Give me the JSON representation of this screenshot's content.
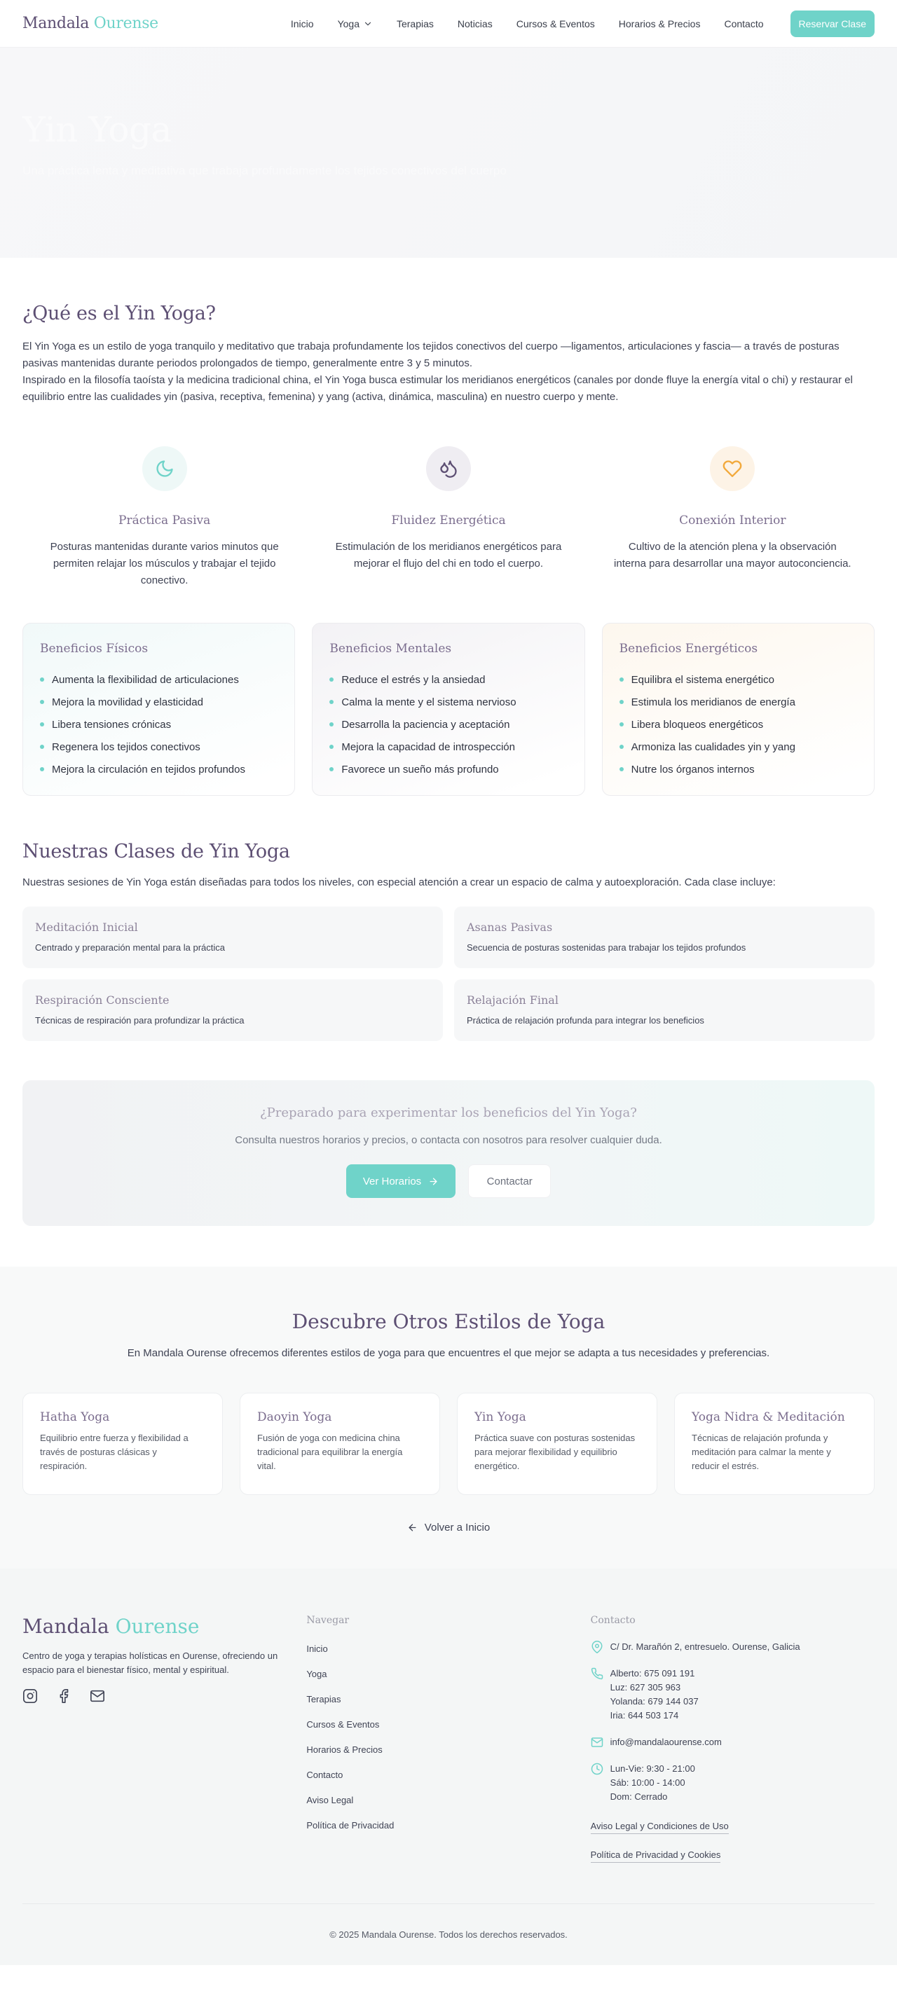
{
  "nav": {
    "logo_main": "Mandala",
    "logo_accent": "Ourense",
    "links": [
      "Inicio",
      "Yoga",
      "Terapias",
      "Noticias",
      "Cursos & Eventos",
      "Horarios & Precios",
      "Contacto"
    ],
    "cta": "Reservar Clase"
  },
  "hero": {
    "title": "Yin Yoga",
    "subtitle": "Una práctica lenta y meditativa que trabaja profundamente los tejidos conectivos del cuerpo"
  },
  "intro": {
    "title": "¿Qué es el Yin Yoga?",
    "p1": "El Yin Yoga es un estilo de yoga tranquilo y meditativo que trabaja profundamente los tejidos conectivos del cuerpo —ligamentos, articulaciones y fascia— a través de posturas pasivas mantenidas durante periodos prolongados de tiempo, generalmente entre 3 y 5 minutos.",
    "p2": "Inspirado en la filosofía taoísta y la medicina tradicional china, el Yin Yoga busca estimular los meridianos energéticos (canales por donde fluye la energía vital o chi) y restaurar el equilibrio entre las cualidades yin (pasiva, receptiva, femenina) y yang (activa, dinámica, masculina) en nuestro cuerpo y mente."
  },
  "pillars": [
    {
      "icon": "moon-icon",
      "title": "Práctica Pasiva",
      "desc": "Posturas mantenidas durante varios minutos que permiten relajar los músculos y trabajar el tejido conectivo."
    },
    {
      "icon": "droplets-icon",
      "title": "Fluidez Energética",
      "desc": "Estimulación de los meridianos energéticos para mejorar el flujo del chi en todo el cuerpo."
    },
    {
      "icon": "heart-icon",
      "title": "Conexión Interior",
      "desc": "Cultivo de la atención plena y la observación interna para desarrollar una mayor autoconciencia."
    }
  ],
  "benefits": [
    {
      "title": "Beneficios Físicos",
      "items": [
        "Aumenta la flexibilidad de articulaciones",
        "Mejora la movilidad y elasticidad",
        "Libera tensiones crónicas",
        "Regenera los tejidos conectivos",
        "Mejora la circulación en tejidos profundos"
      ]
    },
    {
      "title": "Beneficios Mentales",
      "items": [
        "Reduce el estrés y la ansiedad",
        "Calma la mente y el sistema nervioso",
        "Desarrolla la paciencia y aceptación",
        "Mejora la capacidad de introspección",
        "Favorece un sueño más profundo"
      ]
    },
    {
      "title": "Beneficios Energéticos",
      "items": [
        "Equilibra el sistema energético",
        "Estimula los meridianos de energía",
        "Libera bloqueos energéticos",
        "Armoniza las cualidades yin y yang",
        "Nutre los órganos internos"
      ]
    }
  ],
  "classes": {
    "title": "Nuestras Clases de Yin Yoga",
    "intro": "Nuestras sesiones de Yin Yoga están diseñadas para todos los niveles, con especial atención a crear un espacio de calma y autoexploración. Cada clase incluye:",
    "items": [
      {
        "title": "Meditación Inicial",
        "desc": "Centrado y preparación mental para la práctica"
      },
      {
        "title": "Asanas Pasivas",
        "desc": "Secuencia de posturas sostenidas para trabajar los tejidos profundos"
      },
      {
        "title": "Respiración Consciente",
        "desc": "Técnicas de respiración para profundizar la práctica"
      },
      {
        "title": "Relajación Final",
        "desc": "Práctica de relajación profunda para integrar los beneficios"
      }
    ]
  },
  "cta": {
    "title": "¿Preparado para experimentar los beneficios del Yin Yoga?",
    "subtitle": "Consulta nuestros horarios y precios, o contacta con nosotros para resolver cualquier duda.",
    "primary": "Ver Horarios",
    "secondary": "Contactar"
  },
  "others": {
    "title": "Descubre Otros Estilos de Yoga",
    "subtitle": "En Mandala Ourense ofrecemos diferentes estilos de yoga para que encuentres el que mejor se adapta a tus necesidades y preferencias.",
    "styles": [
      {
        "title": "Hatha Yoga",
        "desc": "Equilibrio entre fuerza y flexibilidad a través de posturas clásicas y respiración."
      },
      {
        "title": "Daoyin Yoga",
        "desc": "Fusión de yoga con medicina china tradicional para equilibrar la energía vital."
      },
      {
        "title": "Yin Yoga",
        "desc": "Práctica suave con posturas sostenidas para mejorar flexibilidad y equilibrio energético."
      },
      {
        "title": "Yoga Nidra & Meditación",
        "desc": "Técnicas de relajación profunda y meditación para calmar la mente y reducir el estrés."
      }
    ],
    "back": "Volver a Inicio"
  },
  "footer": {
    "logo_main": "Mandala",
    "logo_accent": "Ourense",
    "desc": "Centro de yoga y terapias holísticas en Ourense, ofreciendo un espacio para el bienestar físico, mental y espiritual.",
    "nav_title": "Navegar",
    "nav_links": [
      "Inicio",
      "Yoga",
      "Terapias",
      "Cursos & Eventos",
      "Horarios & Precios",
      "Contacto",
      "Aviso Legal",
      "Política de Privacidad"
    ],
    "contact_title": "Contacto",
    "address": "C/ Dr. Marañón 2, entresuelo. Ourense, Galicia",
    "phones": [
      "Alberto: 675 091 191",
      "Luz: 627 305 963",
      "Yolanda: 679 144 037",
      "Iria: 644 503 174"
    ],
    "email": "info@mandalaourense.com",
    "hours": [
      "Lun-Vie: 9:30 - 21:00",
      "Sáb: 10:00 - 14:00",
      "Dom: Cerrado"
    ],
    "legal": "Aviso Legal y Condiciones de Uso",
    "privacy": "Política de Privacidad y Cookies",
    "copyright": "© 2025 Mandala Ourense. Todos los derechos reservados."
  },
  "colors": {
    "accent": "#6fd3c9",
    "brand": "#5d4f73",
    "amber": "#f2a93b"
  }
}
